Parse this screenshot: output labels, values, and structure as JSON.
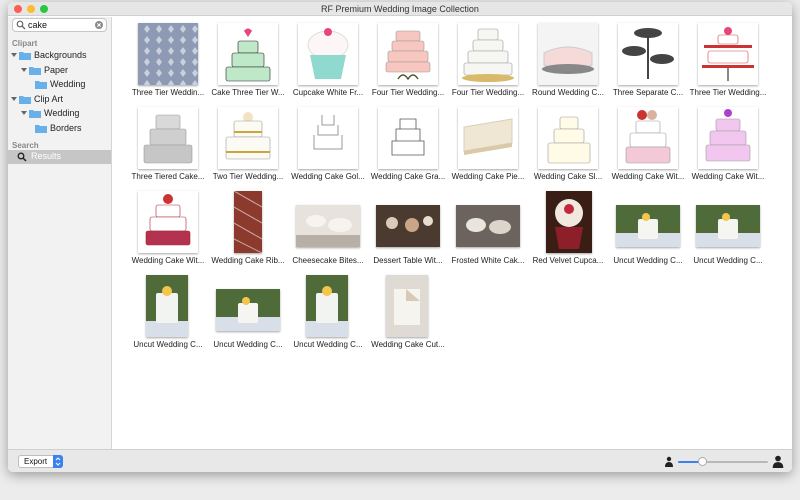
{
  "window": {
    "title": "RF Premium Wedding Image Collection"
  },
  "colors": {
    "close": "#fd5f57",
    "minimize": "#fdbc2e",
    "zoom": "#27c840",
    "accent": "#3b82f0",
    "folder": "#6ab0e8"
  },
  "search": {
    "value": "cake",
    "placeholder": ""
  },
  "sidebar": {
    "clipart_title": "Clipart",
    "backgrounds": "Backgrounds",
    "paper": "Paper",
    "wedding_bg": "Wedding",
    "clip_art": "Clip Art",
    "wedding_ca": "Wedding",
    "borders": "Borders",
    "search_title": "Search",
    "results": "Results"
  },
  "items": [
    {
      "caption": "Three Tier Weddin...",
      "kind": "pattern"
    },
    {
      "caption": "Cake Three Tier W...",
      "kind": "green-cake"
    },
    {
      "caption": "Cupcake White Fr...",
      "kind": "cupcake"
    },
    {
      "caption": "Four Tier Wedding...",
      "kind": "pink-cake"
    },
    {
      "caption": "Four Tier Wedding...",
      "kind": "white-cake"
    },
    {
      "caption": "Round Wedding C...",
      "kind": "round"
    },
    {
      "caption": "Three Separate C...",
      "kind": "stand"
    },
    {
      "caption": "Three Tier Wedding...",
      "kind": "red-stand"
    },
    {
      "caption": "Three Tiered Cake...",
      "kind": "gray-cake"
    },
    {
      "caption": "Two Tier Wedding...",
      "kind": "gold-cake"
    },
    {
      "caption": "Wedding Cake Gol...",
      "kind": "outline"
    },
    {
      "caption": "Wedding Cake Gra...",
      "kind": "sketch"
    },
    {
      "caption": "Wedding Cake Pie...",
      "kind": "slice"
    },
    {
      "caption": "Wedding Cake Sl...",
      "kind": "cream-cake"
    },
    {
      "caption": "Wedding Cake Wit...",
      "kind": "flower-cake"
    },
    {
      "caption": "Wedding Cake Wit...",
      "kind": "purple-cake"
    },
    {
      "caption": "Wedding Cake Wit...",
      "kind": "redwhite-cake"
    },
    {
      "caption": "Wedding Cake Rib...",
      "kind": "ribbon"
    },
    {
      "caption": "Cheesecake Bites...",
      "kind": "photo-light"
    },
    {
      "caption": "Dessert Table Wit...",
      "kind": "photo-dark"
    },
    {
      "caption": "Frosted White Cak...",
      "kind": "photo-mid"
    },
    {
      "caption": "Red Velvet Cupca...",
      "kind": "photo-red"
    },
    {
      "caption": "Uncut Wedding C...",
      "kind": "photo-garden"
    },
    {
      "caption": "Uncut Wedding C...",
      "kind": "photo-garden"
    },
    {
      "caption": "Uncut Wedding C...",
      "kind": "photo-garden-tall"
    },
    {
      "caption": "Uncut Wedding C...",
      "kind": "photo-garden"
    },
    {
      "caption": "Uncut Wedding C...",
      "kind": "photo-garden-tall"
    },
    {
      "caption": "Wedding Cake Cut...",
      "kind": "photo-cut"
    }
  ],
  "footer": {
    "export_label": "Export",
    "zoom_fraction": 0.27
  }
}
